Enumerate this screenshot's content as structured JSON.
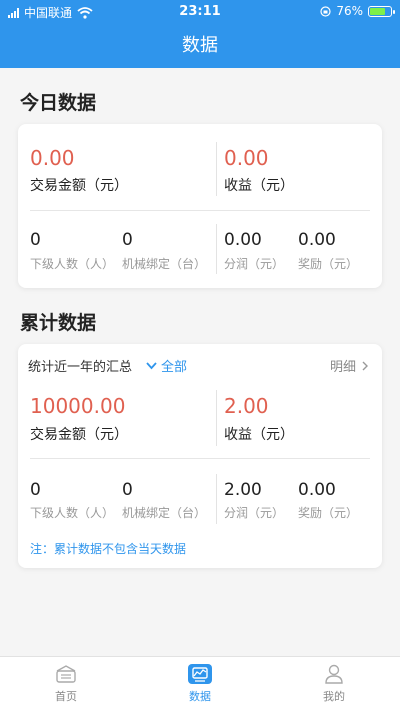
{
  "status_bar": {
    "carrier": "中国联通",
    "time": "23:11",
    "battery_text": "76%",
    "battery_level": 0.76
  },
  "nav": {
    "title": "数据"
  },
  "today": {
    "title": "今日数据",
    "trade_amount": {
      "value": "0.00",
      "label": "交易金额（元）"
    },
    "income": {
      "value": "0.00",
      "label": "收益（元）"
    },
    "stats": [
      {
        "value": "0",
        "label": "下级人数（人）"
      },
      {
        "value": "0",
        "label": "机械绑定（台）"
      },
      {
        "value": "0.00",
        "label": "分润（元）"
      },
      {
        "value": "0.00",
        "label": "奖励（元）"
      }
    ]
  },
  "cumulative": {
    "title": "累计数据",
    "summary_label": "统计近一年的汇总",
    "filter_label": "全部",
    "detail_label": "明细",
    "trade_amount": {
      "value": "10000.00",
      "label": "交易金额（元）"
    },
    "income": {
      "value": "2.00",
      "label": "收益（元）"
    },
    "stats": [
      {
        "value": "0",
        "label": "下级人数（人）"
      },
      {
        "value": "0",
        "label": "机械绑定（台）"
      },
      {
        "value": "2.00",
        "label": "分润（元）"
      },
      {
        "value": "0.00",
        "label": "奖励（元）"
      }
    ],
    "note": "注：累计数据不包含当天数据"
  },
  "tab_bar": {
    "items": [
      {
        "label": "首页"
      },
      {
        "label": "数据"
      },
      {
        "label": "我的"
      }
    ],
    "active": 1
  },
  "colors": {
    "primary": "#2f95ec",
    "amount_red": "#e06050",
    "battery_green": "#7ef04a"
  }
}
